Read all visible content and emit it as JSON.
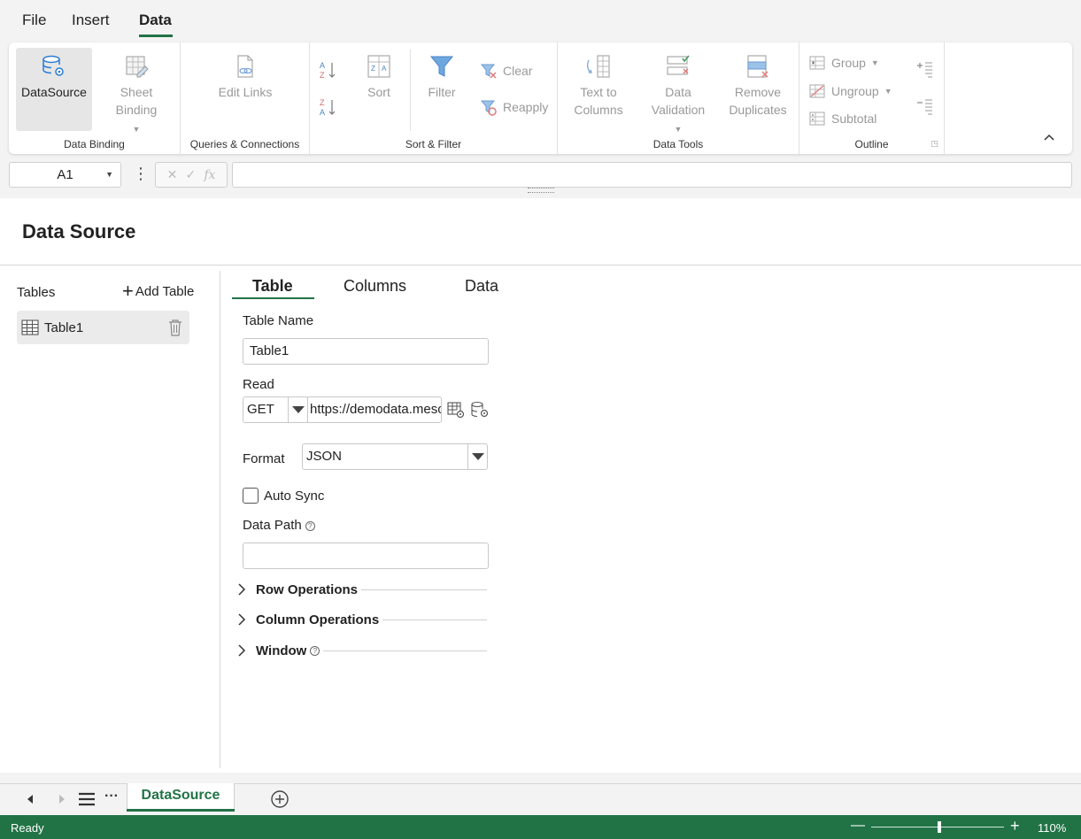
{
  "menu": {
    "file": "File",
    "insert": "Insert",
    "data": "Data"
  },
  "ribbon": {
    "data_binding": {
      "label": "Data Binding",
      "datasource": "DataSource",
      "sheet_binding_1": "Sheet",
      "sheet_binding_2": "Binding"
    },
    "queries": {
      "label": "Queries & Connections",
      "edit_links": "Edit Links"
    },
    "sort_filter": {
      "label": "Sort & Filter",
      "sort": "Sort",
      "filter": "Filter",
      "clear": "Clear",
      "reapply": "Reapply"
    },
    "data_tools": {
      "label": "Data Tools",
      "text_to_columns_1": "Text to",
      "text_to_columns_2": "Columns",
      "data_validation_1": "Data",
      "data_validation_2": "Validation",
      "remove_duplicates_1": "Remove",
      "remove_duplicates_2": "Duplicates"
    },
    "outline": {
      "label": "Outline",
      "group": "Group",
      "ungroup": "Ungroup",
      "subtotal": "Subtotal"
    }
  },
  "formula_bar": {
    "cell_ref": "A1",
    "value": ""
  },
  "panel": {
    "title": "Data Source",
    "tables_label": "Tables",
    "add_table": "Add Table",
    "tables": [
      {
        "name": "Table1"
      }
    ],
    "tabs": {
      "table": "Table",
      "columns": "Columns",
      "data": "Data"
    },
    "form": {
      "table_name_label": "Table Name",
      "table_name_value": "Table1",
      "read_label": "Read",
      "read_method": "GET",
      "read_url": "https://demodata.mescius.io",
      "format_label": "Format",
      "format_value": "JSON",
      "auto_sync_label": "Auto Sync",
      "auto_sync_checked": false,
      "data_path_label": "Data Path",
      "data_path_value": ""
    },
    "sections": {
      "row_operations": "Row Operations",
      "column_operations": "Column Operations",
      "window": "Window"
    }
  },
  "sheets": {
    "active": "DataSource"
  },
  "status": {
    "text": "Ready",
    "zoom": "110%"
  },
  "colors": {
    "accent": "#217346"
  }
}
